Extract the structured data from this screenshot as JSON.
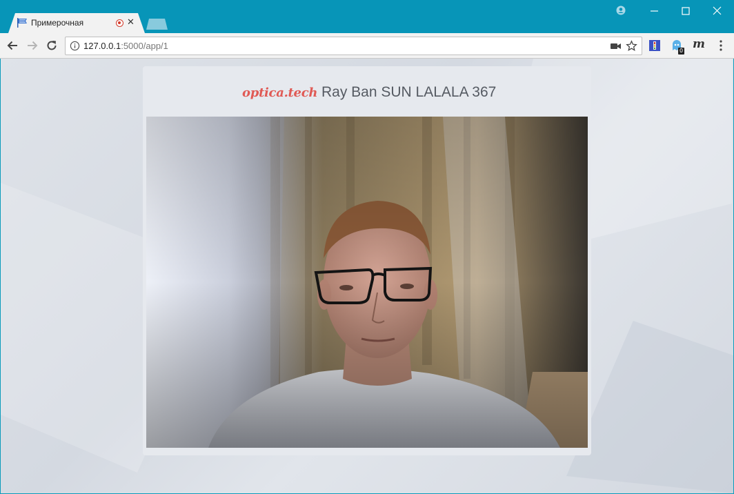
{
  "browser": {
    "tab_title": "Примерочная",
    "tab_close": "✕",
    "url_host": "127.0.0.1",
    "url_path": ":5000/app/1",
    "extension_badge": "0",
    "extension_m": "m"
  },
  "page": {
    "brand": "optica.tech",
    "product_title": "Ray Ban SUN LALALA 367"
  },
  "colors": {
    "titlebar": "#0795b8",
    "brand": "#e05a55",
    "product_text": "#555a62"
  },
  "icons": [
    "flag-icon",
    "recording-icon",
    "close-icon",
    "user-icon",
    "minimize-icon",
    "maximize-icon",
    "window-close-icon",
    "back-icon",
    "forward-icon",
    "reload-icon",
    "info-icon",
    "camera-icon",
    "star-icon",
    "extension-icon",
    "menu-icon"
  ]
}
